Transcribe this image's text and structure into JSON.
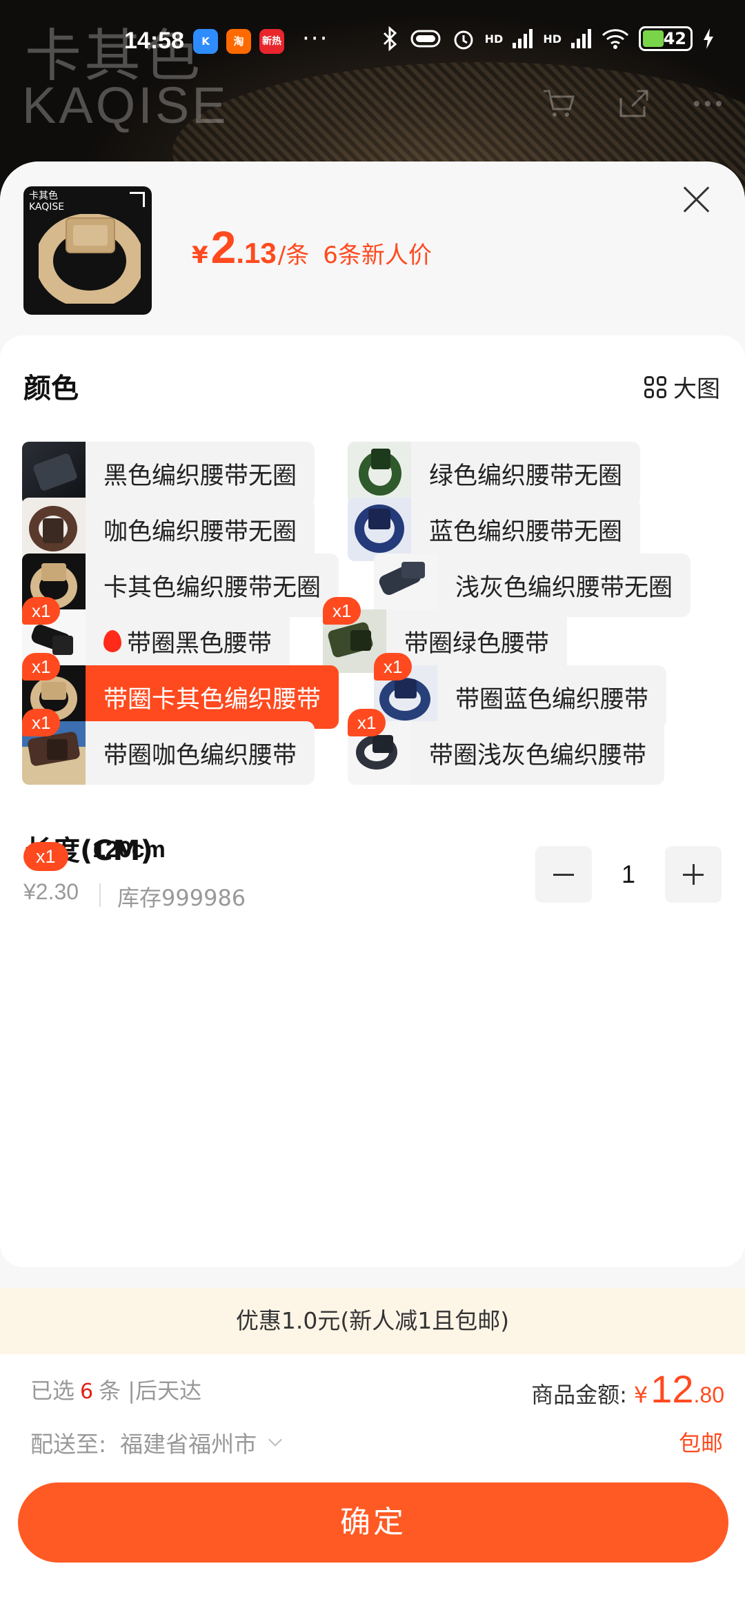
{
  "status_bar": {
    "time": "14:58",
    "apps": [
      "K",
      "淘",
      "新热"
    ],
    "more": "···",
    "signal_1": "HD",
    "signal_2": "HD",
    "battery": "42"
  },
  "background": {
    "brand_cn": "卡其色",
    "brand_en": "KAQISE",
    "icons": [
      "cart-icon",
      "share-icon",
      "more-icon"
    ]
  },
  "header": {
    "thumb_brand_cn": "卡其色",
    "thumb_brand_en": "KAQISE",
    "price_currency": "¥",
    "price_int": "2",
    "price_dec": ".13",
    "price_unit": "/条",
    "price_note": "6条新人价"
  },
  "color_section": {
    "title": "颜色",
    "big_pic_label": "大图",
    "options": [
      {
        "label": "黑色编织腰带无圈",
        "badge": "",
        "selected": false
      },
      {
        "label": "绿色编织腰带无圈",
        "badge": "",
        "selected": false
      },
      {
        "label": "咖色编织腰带无圈",
        "badge": "",
        "selected": false
      },
      {
        "label": "蓝色编织腰带无圈",
        "badge": "",
        "selected": false
      },
      {
        "label": "卡其色编织腰带无圈",
        "badge": "",
        "selected": false
      },
      {
        "label": "浅灰色编织腰带无圈",
        "badge": "",
        "selected": false
      },
      {
        "label": "带圈黑色腰带",
        "badge": "x1",
        "selected": false
      },
      {
        "label": "带圈绿色腰带",
        "badge": "x1",
        "selected": false
      },
      {
        "label": "带圈卡其色编织腰带",
        "badge": "x1",
        "selected": true
      },
      {
        "label": "带圈蓝色编织腰带",
        "badge": "x1",
        "selected": false
      },
      {
        "label": "带圈咖色编织腰带",
        "badge": "x1",
        "selected": false
      },
      {
        "label": "带圈浅灰色编织腰带",
        "badge": "x1",
        "selected": false
      }
    ]
  },
  "length_section": {
    "title": "长度(CM)",
    "item": {
      "badge": "x1",
      "name": "120cm",
      "price": "¥2.30",
      "stock": "库存999986",
      "quantity": "1"
    }
  },
  "promo": "优惠1.0元(新人减1且包邮)",
  "footer": {
    "selected_prefix": "已选",
    "selected_count": "6",
    "selected_suffix": "条 |后天达",
    "amount_label": "商品金额:",
    "amount_currency": "¥",
    "amount_int": "12",
    "amount_dec": ".80",
    "ship_label": "配送至:",
    "ship_location": "福建省福州市",
    "ship_fee": "包邮",
    "confirm_label": "确定"
  },
  "colors": {
    "accent": "#ff4a1f",
    "confirm_button": "#ff5a24",
    "promo_bg": "#fdf5e6"
  }
}
